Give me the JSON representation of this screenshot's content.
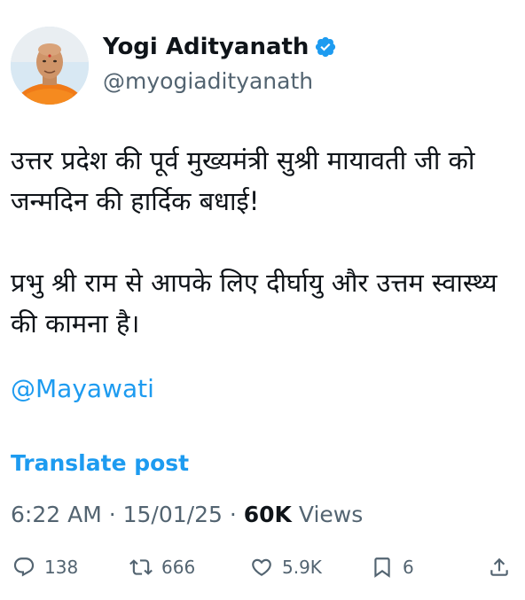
{
  "author": {
    "name": "Yogi Adityanath",
    "handle": "@myogiadityanath",
    "verified_color": "#1d9bf0",
    "avatar_icon": "profile-photo"
  },
  "tweet": {
    "paragraph_1": "उत्तर प्रदेश की पूर्व मुख्यमंत्री सुश्री मायावती जी को जन्मदिन की हार्दिक बधाई!",
    "paragraph_2": "प्रभु श्री राम से आपके लिए दीर्घायु और उत्तम स्वास्थ्य की कामना है।",
    "mention": "@Mayawati",
    "translate_label": "Translate post"
  },
  "meta": {
    "time": "6:22 AM",
    "separator": "·",
    "date": "15/01/25",
    "views_count": "60K",
    "views_label": "Views"
  },
  "actions": {
    "reply_count": "138",
    "repost_count": "666",
    "like_count": "5.9K",
    "bookmark_count": "6"
  },
  "colors": {
    "accent": "#1d9bf0",
    "text": "#0f1419",
    "muted": "#536471"
  }
}
